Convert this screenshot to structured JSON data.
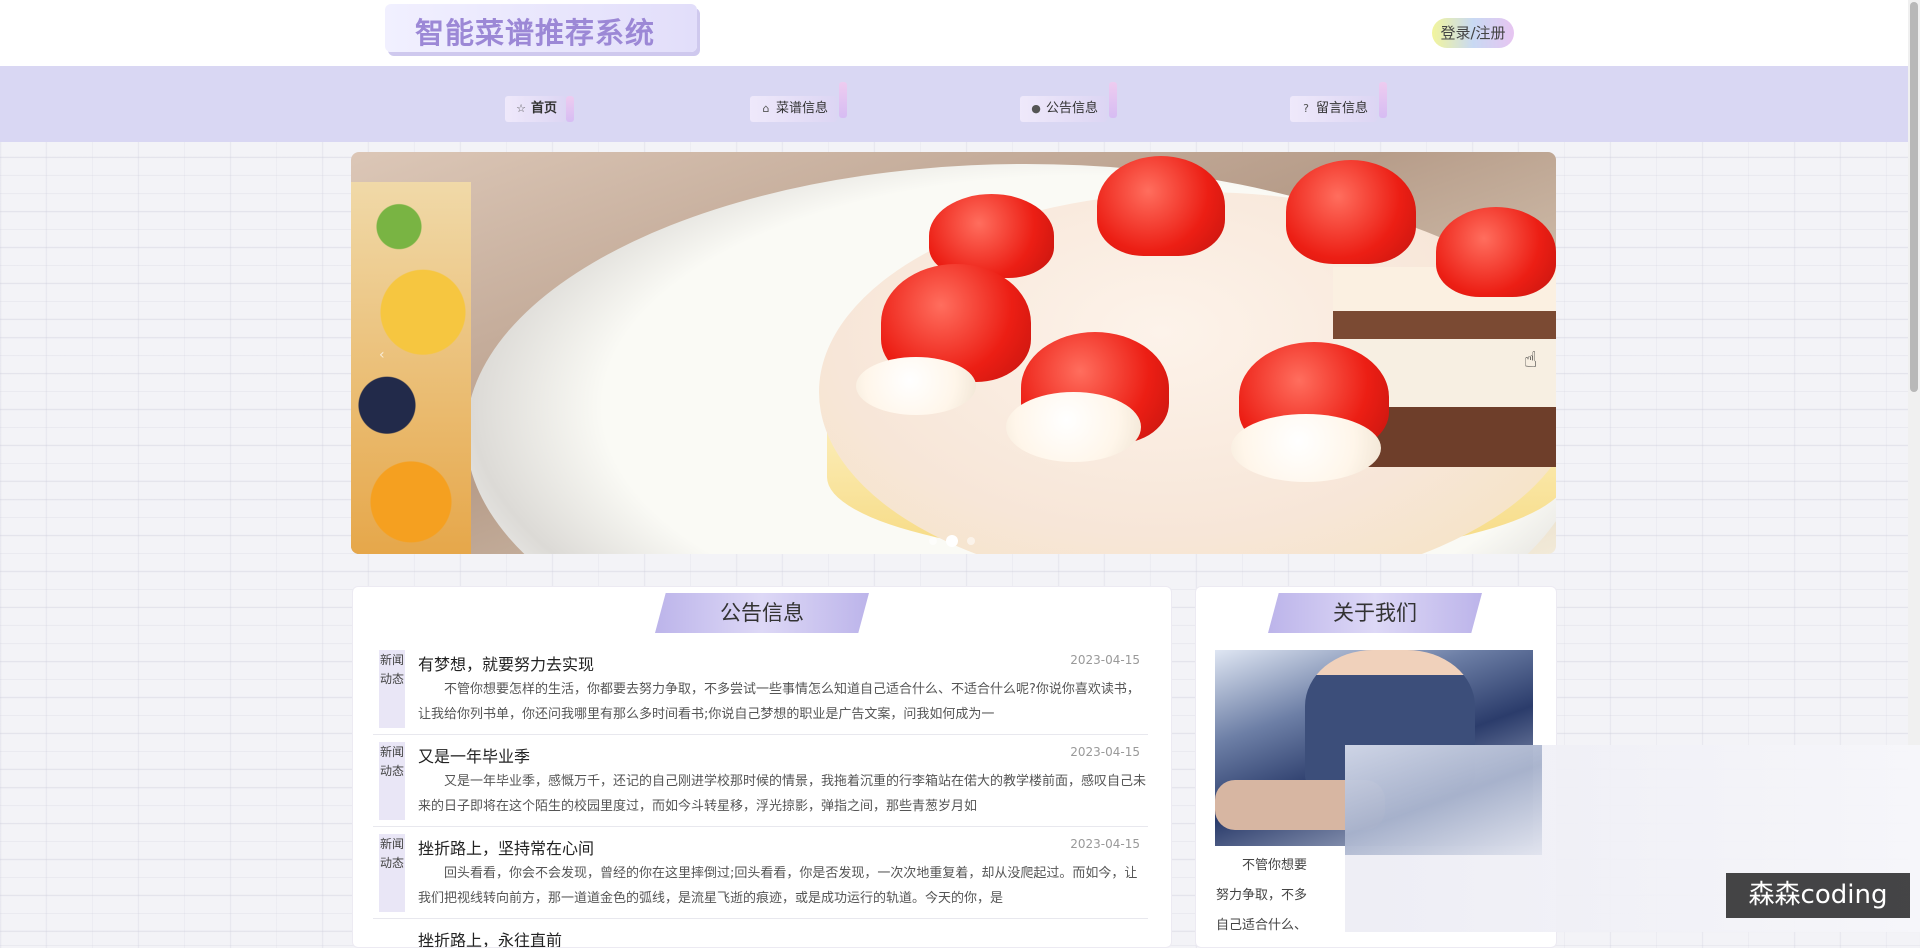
{
  "header": {
    "logo_text": "智能菜谱推荐系统",
    "login_label": "登录/注册"
  },
  "nav": {
    "items": [
      {
        "label": "首页",
        "icon": "star-icon"
      },
      {
        "label": "菜谱信息",
        "icon": "bag-icon"
      },
      {
        "label": "公告信息",
        "icon": "info-icon"
      },
      {
        "label": "留言信息",
        "icon": "question-icon"
      }
    ]
  },
  "carousel": {
    "slide_count": 3,
    "active_slide": 2,
    "prev_arrow": "‹"
  },
  "notice": {
    "title": "公告信息",
    "items": [
      {
        "tag": "新闻动态",
        "title": "有梦想，就要努力去实现",
        "date": "2023-04-15",
        "text": "不管你想要怎样的生活，你都要去努力争取，不多尝试一些事情怎么知道自己适合什么、不适合什么呢?你说你喜欢读书，让我给你列书单，你还问我哪里有那么多时间看书;你说自己梦想的职业是广告文案，问我如何成为一"
      },
      {
        "tag": "新闻动态",
        "title": "又是一年毕业季",
        "date": "2023-04-15",
        "text": "又是一年毕业季，感慨万千，还记的自己刚进学校那时候的情景，我拖着沉重的行李箱站在偌大的教学楼前面，感叹自己未来的日子即将在这个陌生的校园里度过，而如今斗转星移，浮光掠影，弹指之间，那些青葱岁月如"
      },
      {
        "tag": "新闻动态",
        "title": "挫折路上，坚持常在心间",
        "date": "2023-04-15",
        "text": "回头看看，你会不会发现，曾经的你在这里摔倒过;回头看看，你是否发现，一次次地重复着，却从没爬起过。而如今，让我们把视线转向前方，那一道道金色的弧线，是流星飞逝的痕迹，或是成功运行的轨道。今天的你，是"
      }
    ],
    "partial_item_title": "挫折路上，永往直前"
  },
  "about": {
    "title": "关于我们",
    "text_lines": [
      "不管你想要",
      "努力争取，不多",
      "自己适合什么、"
    ]
  },
  "watermark": "森森coding",
  "colors": {
    "accent": "#9c88d6",
    "nav_band": "#d9d7f3",
    "title_banner": "#bcb4ea"
  }
}
